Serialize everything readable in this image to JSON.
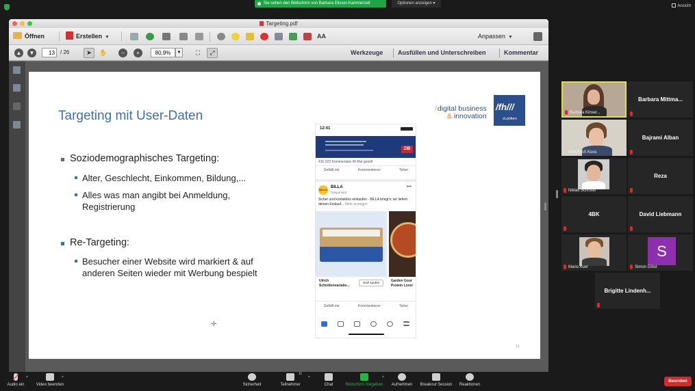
{
  "zoom_top": {
    "share_banner": "Sie sehen den Bildschirm von Barbara Elisser-Kammerzell",
    "options_label": "Optionen anzeigen",
    "view_label": "Ansicht"
  },
  "acrobat": {
    "window_title": "Targeting.pdf",
    "toolbar": {
      "open_label": "Öffnen",
      "create_label": "Erstellen",
      "fit_label": "Anpassen"
    },
    "nav": {
      "current_page": "13",
      "total_pages": "/ 26",
      "zoom": "80,9%",
      "tools_label": "Werkzeuge",
      "fill_sign_label": "Ausfüllen und Unterschreiben",
      "comment_label": "Kommentar"
    }
  },
  "slide": {
    "title": "Targeting mit User-Daten",
    "logo_line1": "digital business",
    "logo_line2": " innovation",
    "logo_mark": "/fh///",
    "logo_sub": "st.pölten",
    "bullet1": "Soziodemographisches Targeting:",
    "bullet1_sub1": "Alter, Geschlecht, Einkommen, Bildung,...",
    "bullet1_sub2_line1": "Alles was man angibt bei Anmeldung,",
    "bullet1_sub2_line2": "Registrierung",
    "bullet2": "Re-Targeting:",
    "bullet2_sub1_line1": "Besucher einer Website wird markiert & auf",
    "bullet2_sub1_line2": "anderen Seiten wieder mit Werbung bespielt",
    "page_number": "13",
    "phone": {
      "time": "12:41",
      "zib": "ZIB",
      "reactions": "416    223 Kommentare   49 Mal geteilt",
      "like": "Gefällt mir",
      "comment": "Kommentieren",
      "share": "Teilen",
      "advertiser": "BILLA",
      "sponsored": "Gesponsert",
      "post_text": "Sicher und kontaktlos einkaufen - BILLA bringt's: wir liefern deinen Einkauf...",
      "more": "Mehr anzeigen",
      "card1_caption": "Ulrich Schnittenvariatio...",
      "card1_button": "Jetzt kaufen",
      "card2_caption": "Garden Gour Protein Lover"
    }
  },
  "participants": [
    {
      "name": "Barbara Kinser...",
      "type": "video",
      "active": true
    },
    {
      "name": "Barbara Mittma...",
      "type": "name"
    },
    {
      "name": "HAK/HAS Koos",
      "type": "video"
    },
    {
      "name": "Bajrami Alban",
      "type": "name"
    },
    {
      "name": "Niklas Schröfel",
      "type": "video"
    },
    {
      "name": "Reza",
      "type": "name"
    },
    {
      "name": "4BK",
      "type": "name"
    },
    {
      "name": "David Liebmann",
      "type": "name"
    },
    {
      "name": "Mario Auer",
      "type": "video"
    },
    {
      "name": "Simon Glöst",
      "type": "avatar",
      "initial": "S",
      "avatar_color": "#8e2fae"
    },
    {
      "name": "Brigitte Lindenh...",
      "type": "name"
    }
  ],
  "zoom_bar": {
    "audio": "Audio ein",
    "video": "Video beenden",
    "security": "Sicherheit",
    "participants": "Teilnehmer",
    "participants_count": "11",
    "chat": "Chat",
    "share": "Bildschirm freigeben",
    "record": "Aufnehmen",
    "breakout": "Breakout Session",
    "reactions": "Reaktionen",
    "end": "Beenden"
  },
  "colors": {
    "share_green": "#21a347",
    "slide_title": "#3f6fa8",
    "logo_blue": "#2a4f8c",
    "end_red": "#d32b2b",
    "active_tile": "#e0e040"
  }
}
